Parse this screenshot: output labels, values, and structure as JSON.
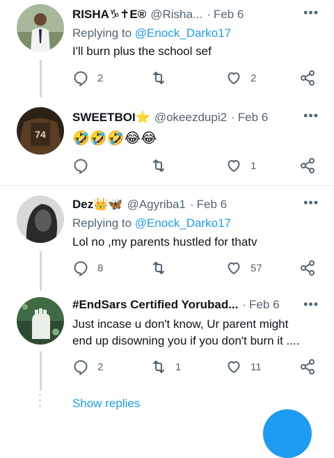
{
  "more_icon": "more-horizontal-icon",
  "tweets": [
    {
      "name": "RISHA♑✝E®",
      "handle": "@Risha...",
      "date": "Feb 6",
      "replying_label": "Replying to",
      "replying_mention": "@Enock_Darko17",
      "text": "I'll burn plus the school sef",
      "reply_count": "2",
      "retweet_count": "",
      "like_count": "2"
    },
    {
      "name": "SWEETBOI⭐",
      "handle": "@okeezdupi2",
      "date": "Feb 6",
      "text": "🤣🤣🤣😂😂",
      "reply_count": "",
      "retweet_count": "",
      "like_count": "1",
      "avatar_label": "74"
    },
    {
      "name": "Dez👑🦋",
      "handle": "@Agyriba1",
      "date": "Feb 6",
      "replying_label": "Replying to",
      "replying_mention": "@Enock_Darko17",
      "text": "Lol no ,my parents hustled for thatv",
      "reply_count": "8",
      "retweet_count": "",
      "like_count": "57"
    },
    {
      "name": "#EndSars Certified Yorubad...",
      "handle": "",
      "date": "Feb 6",
      "text_line1": "Just incase u don't know, Ur parent might",
      "text_line2": "end up disowning you if you don't burn it ....",
      "reply_count": "2",
      "retweet_count": "1",
      "like_count": "11"
    }
  ],
  "show_replies": "Show replies",
  "colors": {
    "accent": "#1d9bf0",
    "muted": "#536471",
    "line": "#cfd9de"
  }
}
